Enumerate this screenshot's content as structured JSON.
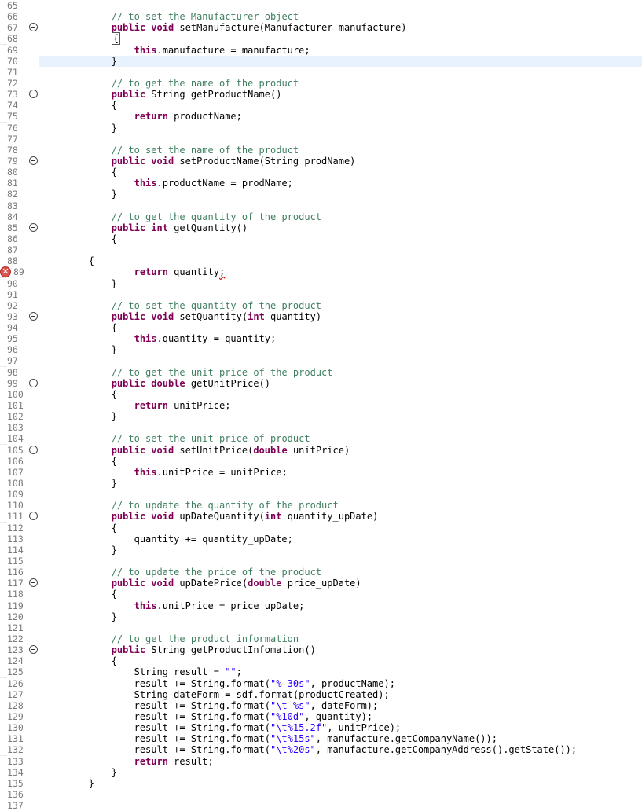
{
  "editor": {
    "lines": [
      {
        "n": "65",
        "fold": false,
        "err": false,
        "current": false,
        "tokens": []
      },
      {
        "n": "66",
        "tokens": [
          {
            "t": "            "
          },
          {
            "t": "// to set the Manufacturer object",
            "c": "c"
          }
        ]
      },
      {
        "n": "67",
        "fold": true,
        "tokens": [
          {
            "t": "            "
          },
          {
            "t": "public",
            "c": "k"
          },
          {
            "t": " "
          },
          {
            "t": "void",
            "c": "k"
          },
          {
            "t": " setManufacture(Manufacturer manufacture)"
          }
        ]
      },
      {
        "n": "68",
        "tokens": [
          {
            "t": "            "
          },
          {
            "t": "{",
            "c": "box"
          }
        ]
      },
      {
        "n": "69",
        "tokens": [
          {
            "t": "                "
          },
          {
            "t": "this",
            "c": "k"
          },
          {
            "t": ".manufacture = manufacture;"
          }
        ]
      },
      {
        "n": "70",
        "current": true,
        "tokens": [
          {
            "t": "            }"
          }
        ]
      },
      {
        "n": "71",
        "tokens": []
      },
      {
        "n": "72",
        "tokens": [
          {
            "t": "            "
          },
          {
            "t": "// to get the name of the product",
            "c": "c"
          }
        ]
      },
      {
        "n": "73",
        "fold": true,
        "tokens": [
          {
            "t": "            "
          },
          {
            "t": "public",
            "c": "k"
          },
          {
            "t": " String getProductName()"
          }
        ]
      },
      {
        "n": "74",
        "tokens": [
          {
            "t": "            {"
          }
        ]
      },
      {
        "n": "75",
        "tokens": [
          {
            "t": "                "
          },
          {
            "t": "return",
            "c": "k"
          },
          {
            "t": " productName;"
          }
        ]
      },
      {
        "n": "76",
        "tokens": [
          {
            "t": "            }"
          }
        ]
      },
      {
        "n": "77",
        "tokens": []
      },
      {
        "n": "78",
        "tokens": [
          {
            "t": "            "
          },
          {
            "t": "// to set the name of the product",
            "c": "c"
          }
        ]
      },
      {
        "n": "79",
        "fold": true,
        "tokens": [
          {
            "t": "            "
          },
          {
            "t": "public",
            "c": "k"
          },
          {
            "t": " "
          },
          {
            "t": "void",
            "c": "k"
          },
          {
            "t": " setProductName(String prodName)"
          }
        ]
      },
      {
        "n": "80",
        "tokens": [
          {
            "t": "            {"
          }
        ]
      },
      {
        "n": "81",
        "tokens": [
          {
            "t": "                "
          },
          {
            "t": "this",
            "c": "k"
          },
          {
            "t": ".productName = prodName;"
          }
        ]
      },
      {
        "n": "82",
        "tokens": [
          {
            "t": "            }"
          }
        ]
      },
      {
        "n": "83",
        "tokens": []
      },
      {
        "n": "84",
        "tokens": [
          {
            "t": "            "
          },
          {
            "t": "// to get the quantity of the product",
            "c": "c"
          }
        ]
      },
      {
        "n": "85",
        "fold": true,
        "tokens": [
          {
            "t": "            "
          },
          {
            "t": "public",
            "c": "k"
          },
          {
            "t": " "
          },
          {
            "t": "int",
            "c": "k"
          },
          {
            "t": " getQuantity()"
          }
        ]
      },
      {
        "n": "86",
        "tokens": [
          {
            "t": "            {"
          }
        ]
      },
      {
        "n": "87",
        "tokens": []
      },
      {
        "n": "88",
        "tokens": [
          {
            "t": "        {"
          }
        ]
      },
      {
        "n": "89",
        "err": true,
        "tokens": [
          {
            "t": "                "
          },
          {
            "t": "return",
            "c": "k"
          },
          {
            "t": " quantity"
          },
          {
            "t": ";",
            "c": "squig"
          }
        ]
      },
      {
        "n": "90",
        "tokens": [
          {
            "t": "            }"
          }
        ]
      },
      {
        "n": "91",
        "tokens": []
      },
      {
        "n": "92",
        "tokens": [
          {
            "t": "            "
          },
          {
            "t": "// to set the quantity of the product",
            "c": "c"
          }
        ]
      },
      {
        "n": "93",
        "fold": true,
        "tokens": [
          {
            "t": "            "
          },
          {
            "t": "public",
            "c": "k"
          },
          {
            "t": " "
          },
          {
            "t": "void",
            "c": "k"
          },
          {
            "t": " setQuantity("
          },
          {
            "t": "int",
            "c": "k"
          },
          {
            "t": " quantity)"
          }
        ]
      },
      {
        "n": "94",
        "tokens": [
          {
            "t": "            {"
          }
        ]
      },
      {
        "n": "95",
        "tokens": [
          {
            "t": "                "
          },
          {
            "t": "this",
            "c": "k"
          },
          {
            "t": ".quantity = quantity;"
          }
        ]
      },
      {
        "n": "96",
        "tokens": [
          {
            "t": "            }"
          }
        ]
      },
      {
        "n": "97",
        "tokens": []
      },
      {
        "n": "98",
        "tokens": [
          {
            "t": "            "
          },
          {
            "t": "// to get the unit price of the product",
            "c": "c"
          }
        ]
      },
      {
        "n": "99",
        "fold": true,
        "tokens": [
          {
            "t": "            "
          },
          {
            "t": "public",
            "c": "k"
          },
          {
            "t": " "
          },
          {
            "t": "double",
            "c": "k"
          },
          {
            "t": " getUnitPrice()"
          }
        ]
      },
      {
        "n": "100",
        "tokens": [
          {
            "t": "            {"
          }
        ]
      },
      {
        "n": "101",
        "tokens": [
          {
            "t": "                "
          },
          {
            "t": "return",
            "c": "k"
          },
          {
            "t": " unitPrice;"
          }
        ]
      },
      {
        "n": "102",
        "tokens": [
          {
            "t": "            }"
          }
        ]
      },
      {
        "n": "103",
        "tokens": []
      },
      {
        "n": "104",
        "tokens": [
          {
            "t": "            "
          },
          {
            "t": "// to set the unit price of product",
            "c": "c"
          }
        ]
      },
      {
        "n": "105",
        "fold": true,
        "tokens": [
          {
            "t": "            "
          },
          {
            "t": "public",
            "c": "k"
          },
          {
            "t": " "
          },
          {
            "t": "void",
            "c": "k"
          },
          {
            "t": " setUnitPrice("
          },
          {
            "t": "double",
            "c": "k"
          },
          {
            "t": " unitPrice)"
          }
        ]
      },
      {
        "n": "106",
        "tokens": [
          {
            "t": "            {"
          }
        ]
      },
      {
        "n": "107",
        "tokens": [
          {
            "t": "                "
          },
          {
            "t": "this",
            "c": "k"
          },
          {
            "t": ".unitPrice = unitPrice;"
          }
        ]
      },
      {
        "n": "108",
        "tokens": [
          {
            "t": "            }"
          }
        ]
      },
      {
        "n": "109",
        "tokens": []
      },
      {
        "n": "110",
        "tokens": [
          {
            "t": "            "
          },
          {
            "t": "// to update the quantity of the product",
            "c": "c"
          }
        ]
      },
      {
        "n": "111",
        "fold": true,
        "tokens": [
          {
            "t": "            "
          },
          {
            "t": "public",
            "c": "k"
          },
          {
            "t": " "
          },
          {
            "t": "void",
            "c": "k"
          },
          {
            "t": " upDateQuantity("
          },
          {
            "t": "int",
            "c": "k"
          },
          {
            "t": " quantity_upDate)"
          }
        ]
      },
      {
        "n": "112",
        "tokens": [
          {
            "t": "            {"
          }
        ]
      },
      {
        "n": "113",
        "tokens": [
          {
            "t": "                quantity += quantity_upDate;"
          }
        ]
      },
      {
        "n": "114",
        "tokens": [
          {
            "t": "            }"
          }
        ]
      },
      {
        "n": "115",
        "tokens": []
      },
      {
        "n": "116",
        "tokens": [
          {
            "t": "            "
          },
          {
            "t": "// to update the price of the product",
            "c": "c"
          }
        ]
      },
      {
        "n": "117",
        "fold": true,
        "tokens": [
          {
            "t": "            "
          },
          {
            "t": "public",
            "c": "k"
          },
          {
            "t": " "
          },
          {
            "t": "void",
            "c": "k"
          },
          {
            "t": " upDatePrice("
          },
          {
            "t": "double",
            "c": "k"
          },
          {
            "t": " price_upDate)"
          }
        ]
      },
      {
        "n": "118",
        "tokens": [
          {
            "t": "            {"
          }
        ]
      },
      {
        "n": "119",
        "tokens": [
          {
            "t": "                "
          },
          {
            "t": "this",
            "c": "k"
          },
          {
            "t": ".unitPrice = price_upDate;"
          }
        ]
      },
      {
        "n": "120",
        "tokens": [
          {
            "t": "            }"
          }
        ]
      },
      {
        "n": "121",
        "tokens": []
      },
      {
        "n": "122",
        "tokens": [
          {
            "t": "            "
          },
          {
            "t": "// to get the product information",
            "c": "c"
          }
        ]
      },
      {
        "n": "123",
        "fold": true,
        "tokens": [
          {
            "t": "            "
          },
          {
            "t": "public",
            "c": "k"
          },
          {
            "t": " String getProductInfomation()"
          }
        ]
      },
      {
        "n": "124",
        "tokens": [
          {
            "t": "            {"
          }
        ]
      },
      {
        "n": "125",
        "tokens": [
          {
            "t": "                String result = "
          },
          {
            "t": "\"\"",
            "c": "s"
          },
          {
            "t": ";"
          }
        ]
      },
      {
        "n": "126",
        "tokens": [
          {
            "t": "                result += String.format("
          },
          {
            "t": "\"%-30s\"",
            "c": "s"
          },
          {
            "t": ", productName);"
          }
        ]
      },
      {
        "n": "127",
        "tokens": [
          {
            "t": "                String dateForm = sdf.format(productCreated);"
          }
        ]
      },
      {
        "n": "128",
        "tokens": [
          {
            "t": "                result += String.format("
          },
          {
            "t": "\"\\t %s\"",
            "c": "s"
          },
          {
            "t": ", dateForm);"
          }
        ]
      },
      {
        "n": "129",
        "tokens": [
          {
            "t": "                result += String.format("
          },
          {
            "t": "\"%10d\"",
            "c": "s"
          },
          {
            "t": ", quantity);"
          }
        ]
      },
      {
        "n": "130",
        "tokens": [
          {
            "t": "                result += String.format("
          },
          {
            "t": "\"\\t%15.2f\"",
            "c": "s"
          },
          {
            "t": ", unitPrice);"
          }
        ]
      },
      {
        "n": "131",
        "tokens": [
          {
            "t": "                result += String.format("
          },
          {
            "t": "\"\\t%15s\"",
            "c": "s"
          },
          {
            "t": ", manufacture.getCompanyName());"
          }
        ]
      },
      {
        "n": "132",
        "tokens": [
          {
            "t": "                result += String.format("
          },
          {
            "t": "\"\\t%20s\"",
            "c": "s"
          },
          {
            "t": ", manufacture.getCompanyAddress().getState());"
          }
        ]
      },
      {
        "n": "133",
        "tokens": [
          {
            "t": "                "
          },
          {
            "t": "return",
            "c": "k"
          },
          {
            "t": " result;"
          }
        ]
      },
      {
        "n": "134",
        "tokens": [
          {
            "t": "            }"
          }
        ]
      },
      {
        "n": "135",
        "tokens": [
          {
            "t": "        }"
          }
        ]
      },
      {
        "n": "136",
        "tokens": []
      },
      {
        "n": "137",
        "tokens": []
      }
    ]
  },
  "colors": {
    "keyword": "#7f0055",
    "comment": "#3f7f5f",
    "string": "#2a00ff",
    "current_line": "#e8f2fe",
    "error_marker": "#d9534f"
  },
  "icons": {
    "fold": "fold-collapse-icon",
    "error": "error-marker-icon"
  }
}
